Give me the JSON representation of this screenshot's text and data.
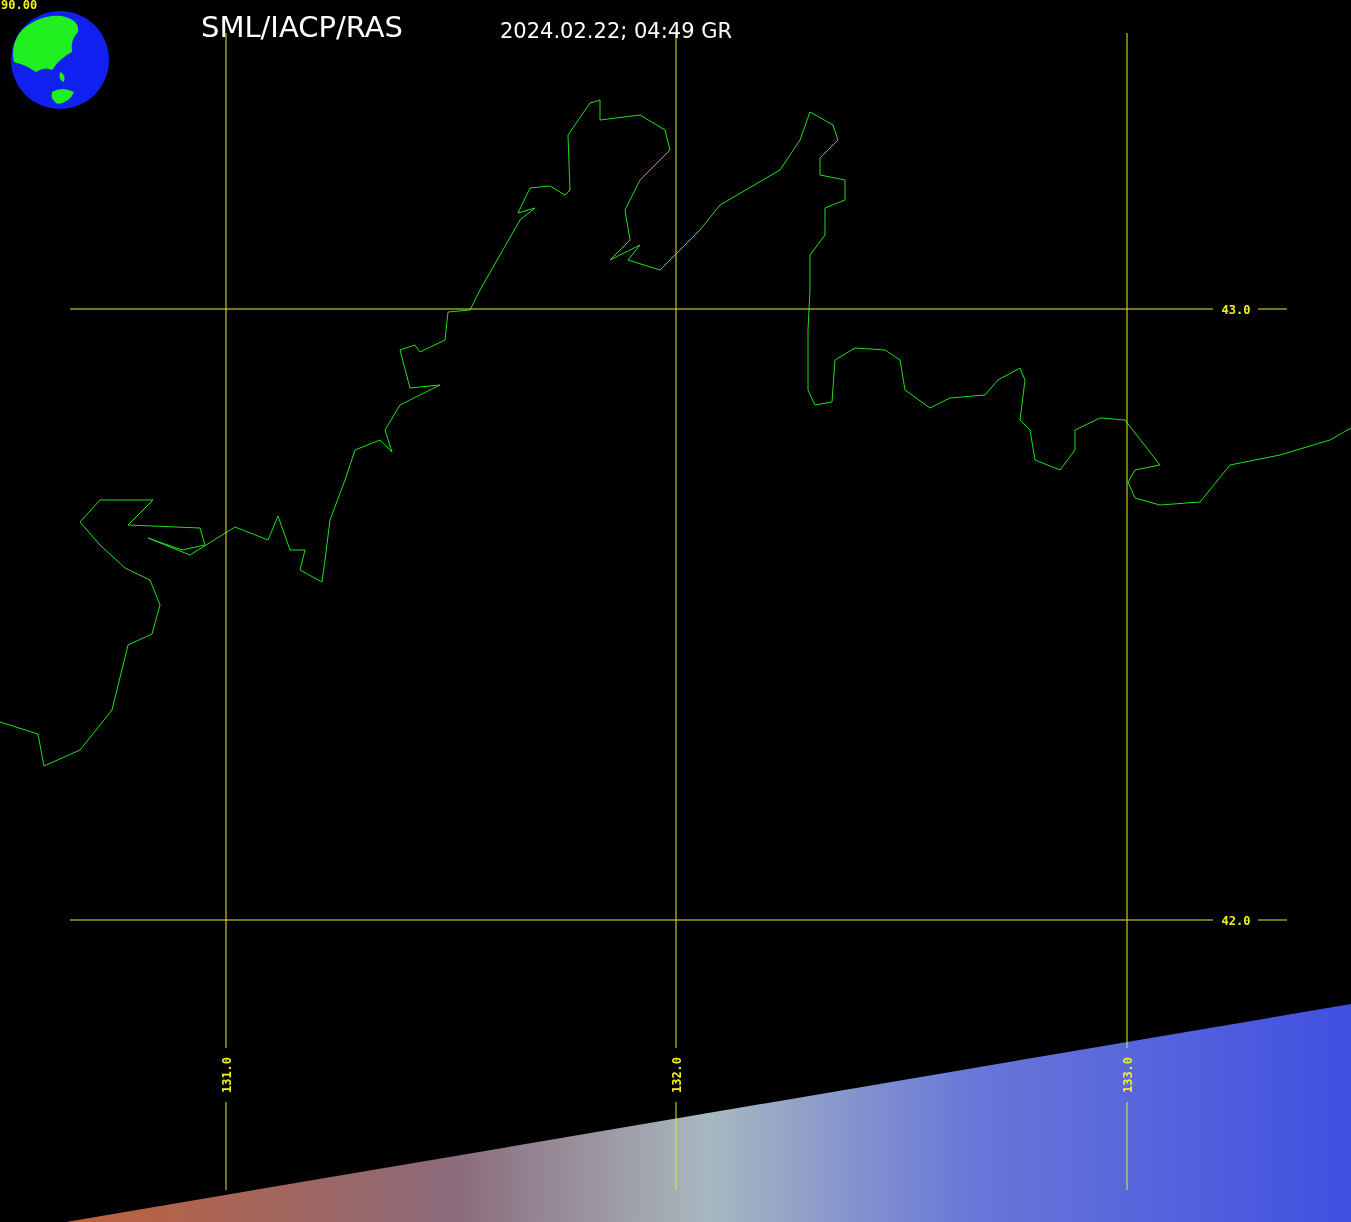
{
  "globe": {
    "label": "90.00"
  },
  "title": "SML/IACP/RAS",
  "timestamp": "2024.02.22; 04:49 GR",
  "latitude_lines": [
    {
      "label": "43.0"
    },
    {
      "label": "42.0"
    }
  ],
  "longitude_lines": [
    {
      "label": "131.0"
    },
    {
      "label": "132.0"
    },
    {
      "label": "133.0"
    }
  ]
}
